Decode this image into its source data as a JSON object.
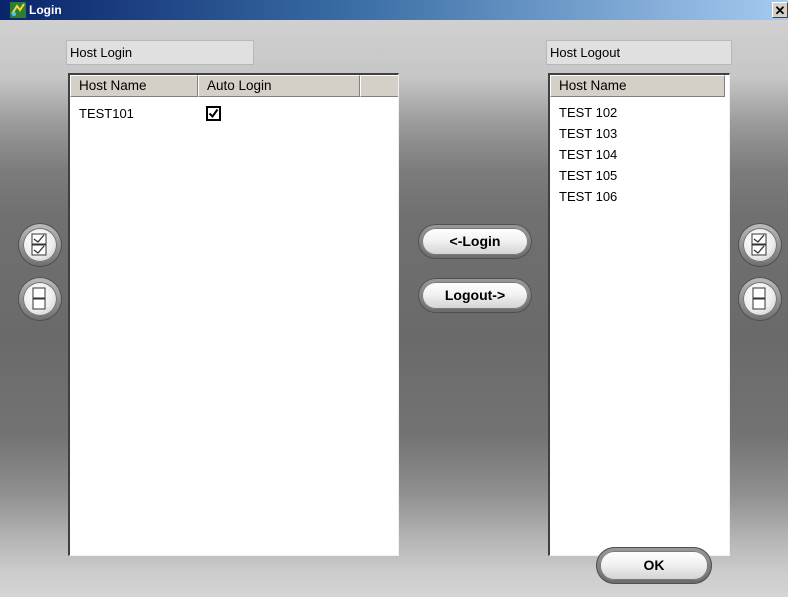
{
  "window": {
    "title": "Login",
    "close_glyph": "✕"
  },
  "login_panel": {
    "caption": "Host Login",
    "columns": [
      "Host Name",
      "Auto Login"
    ],
    "rows": [
      {
        "host": "TEST101",
        "auto_login": true
      }
    ]
  },
  "logout_panel": {
    "caption": "Host Logout",
    "columns": [
      "Host Name"
    ],
    "rows": [
      "TEST 102",
      "TEST 103",
      "TEST 104",
      "TEST 105",
      "TEST 106"
    ]
  },
  "buttons": {
    "login": "<-Login",
    "logout": "Logout->",
    "ok": "OK"
  },
  "icons": {
    "app": "app-login-icon",
    "select_all": "select-all-icon",
    "deselect_all": "deselect-all-icon",
    "close": "close-icon"
  }
}
